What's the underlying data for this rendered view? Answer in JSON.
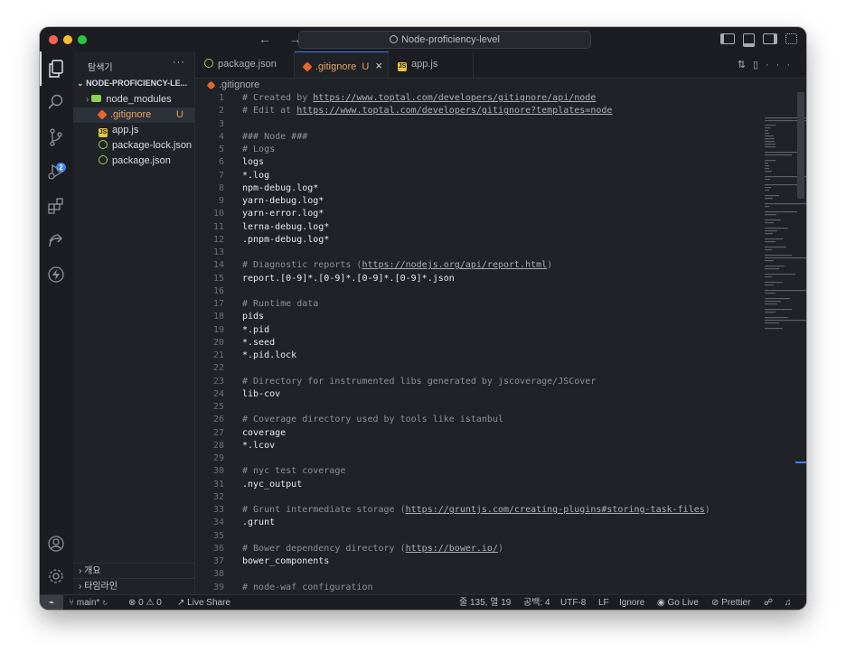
{
  "window": {
    "search_label": "Node-proficiency-level",
    "nav_arrows": "← →"
  },
  "sidebar": {
    "title": "탐색기",
    "more": "···",
    "project": "NODE-PROFICIENCY-LE...",
    "items": [
      {
        "label": "node_modules",
        "icon": "folder-icon",
        "status": ""
      },
      {
        "label": ".gitignore",
        "icon": "git-icon",
        "status": "U"
      },
      {
        "label": "app.js",
        "icon": "js-icon",
        "status": ""
      },
      {
        "label": "package-lock.json",
        "icon": "json-icon",
        "status": ""
      },
      {
        "label": "package.json",
        "icon": "json-icon",
        "status": ""
      }
    ],
    "bottom": [
      {
        "label": "개요"
      },
      {
        "label": "타임라인"
      }
    ]
  },
  "activity_badge": "2",
  "tabs": [
    {
      "label": "package.json",
      "icon": "json-icon"
    },
    {
      "label": ".gitignore",
      "status": "U",
      "close": "×",
      "icon": "git-icon"
    },
    {
      "label": "app.js",
      "icon": "js-icon"
    }
  ],
  "breadcrumb": ".gitignore",
  "code_lines": [
    {
      "n": "1",
      "text": "# Created by https://www.toptal.com/developers/gitignore/api/node"
    },
    {
      "n": "2",
      "text": "# Edit at https://www.toptal.com/developers/gitignore?templates=node"
    },
    {
      "n": "3",
      "text": ""
    },
    {
      "n": "4",
      "text": "### Node ###"
    },
    {
      "n": "5",
      "text": "# Logs"
    },
    {
      "n": "6",
      "text": "logs"
    },
    {
      "n": "7",
      "text": "*.log"
    },
    {
      "n": "8",
      "text": "npm-debug.log*"
    },
    {
      "n": "9",
      "text": "yarn-debug.log*"
    },
    {
      "n": "10",
      "text": "yarn-error.log*"
    },
    {
      "n": "11",
      "text": "lerna-debug.log*"
    },
    {
      "n": "12",
      "text": ".pnpm-debug.log*"
    },
    {
      "n": "13",
      "text": ""
    },
    {
      "n": "14",
      "text": "# Diagnostic reports (https://nodejs.org/api/report.html)"
    },
    {
      "n": "15",
      "text": "report.[0-9]*.[0-9]*.[0-9]*.[0-9]*.json"
    },
    {
      "n": "16",
      "text": ""
    },
    {
      "n": "17",
      "text": "# Runtime data"
    },
    {
      "n": "18",
      "text": "pids"
    },
    {
      "n": "19",
      "text": "*.pid"
    },
    {
      "n": "20",
      "text": "*.seed"
    },
    {
      "n": "21",
      "text": "*.pid.lock"
    },
    {
      "n": "22",
      "text": ""
    },
    {
      "n": "23",
      "text": "# Directory for instrumented libs generated by jscoverage/JSCover"
    },
    {
      "n": "24",
      "text": "lib-cov"
    },
    {
      "n": "25",
      "text": ""
    },
    {
      "n": "26",
      "text": "# Coverage directory used by tools like istanbul"
    },
    {
      "n": "27",
      "text": "coverage"
    },
    {
      "n": "28",
      "text": "*.lcov"
    },
    {
      "n": "29",
      "text": ""
    },
    {
      "n": "30",
      "text": "# nyc test coverage"
    },
    {
      "n": "31",
      "text": ".nyc_output"
    },
    {
      "n": "32",
      "text": ""
    },
    {
      "n": "33",
      "text": "# Grunt intermediate storage (https://gruntjs.com/creating-plugins#storing-task-files)"
    },
    {
      "n": "34",
      "text": ".grunt"
    },
    {
      "n": "35",
      "text": ""
    },
    {
      "n": "36",
      "text": "# Bower dependency directory (https://bower.io/)"
    },
    {
      "n": "37",
      "text": "bower_components"
    },
    {
      "n": "38",
      "text": ""
    },
    {
      "n": "39",
      "text": "# node-waf configuration"
    }
  ],
  "status": {
    "branch": "main*",
    "errors": "0",
    "warnings": "0",
    "live_share": "Live Share",
    "position": "줄 135, 열 19",
    "spaces": "공백: 4",
    "encoding": "UTF-8",
    "eol": "LF",
    "language": "Ignore",
    "go_live": "Go Live",
    "prettier": "Prettier"
  },
  "colors": {
    "accent": "#3b82f6",
    "git_icon": "#e8632f",
    "js_icon": "#e8c53a",
    "json_icon": "#9fce4f",
    "folder_icon": "#8fd14f",
    "untracked": "#e8a060"
  }
}
